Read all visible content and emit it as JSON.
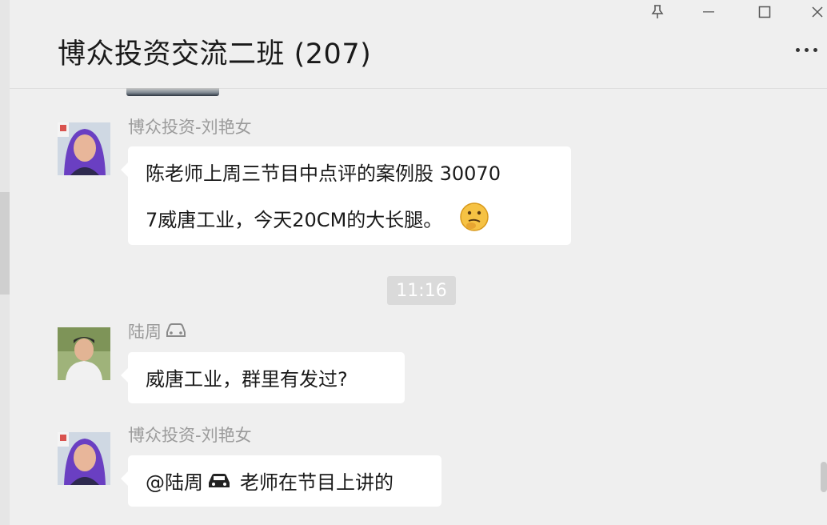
{
  "header": {
    "title": "博众投资交流二班 (207)"
  },
  "window_controls": [
    "pin-icon",
    "minimize-icon",
    "maximize-icon",
    "close-icon"
  ],
  "messages": [
    {
      "sender": "博众投资-刘艳女",
      "lines": [
        "陈老师上周三节目中点评的案例股 30070",
        "7威唐工业，今天20CM的大长腿。"
      ],
      "emoji": "thinking-face-emoji"
    },
    {
      "sender": "陆周",
      "sender_icon": "car-icon",
      "lines": [
        "威唐工业，群里有发过?"
      ]
    },
    {
      "sender": "博众投资-刘艳女",
      "mention": "@陆周",
      "mention_icon": "car-icon",
      "lines": [
        "老师在节目上讲的"
      ]
    }
  ],
  "timestamp": "11:16",
  "colors": {
    "background": "#efefef",
    "bubble": "#ffffff",
    "sender_text": "#9b9b9b",
    "timestamp_bg": "#dadada"
  }
}
